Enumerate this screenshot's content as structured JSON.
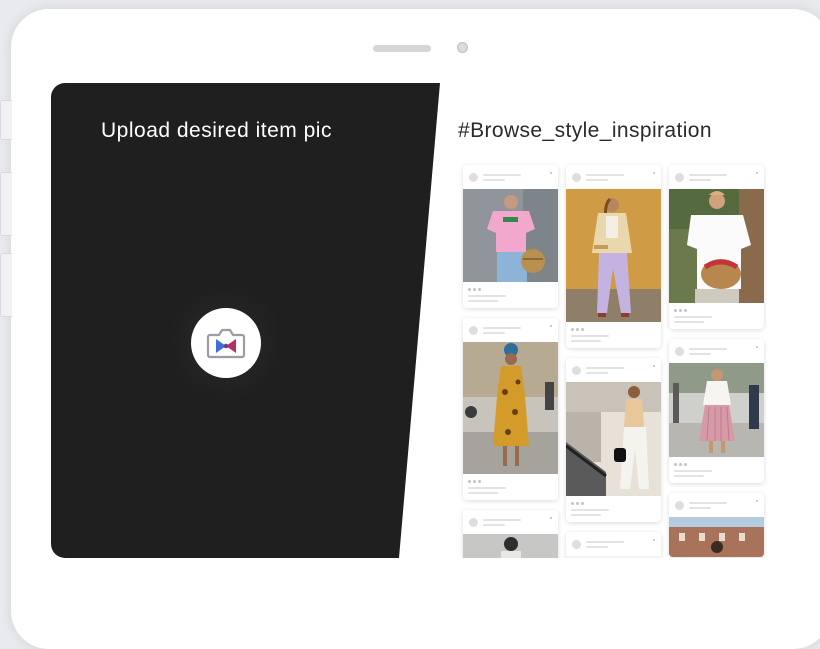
{
  "left_panel": {
    "title": "Upload desired item pic",
    "camera_button_icon": "camera-icon"
  },
  "right_panel": {
    "title": "#Browse_style_inspiration"
  },
  "colors": {
    "dark_panel": "#1f1f1f",
    "camera_bow_left": "#3f6ed8",
    "camera_bow_right": "#b2315f"
  },
  "feed": {
    "column_1": [
      "photo-pink-tee-straw-bag",
      "photo-yellow-floral-dress",
      "photo-partial"
    ],
    "column_2": [
      "photo-cream-blazer-lilac-pants",
      "photo-white-pants-black-bag",
      "photo-partial"
    ],
    "column_3": [
      "photo-white-blouse-woven-bag",
      "photo-pink-pleated-skirt",
      "photo-city-building"
    ]
  }
}
